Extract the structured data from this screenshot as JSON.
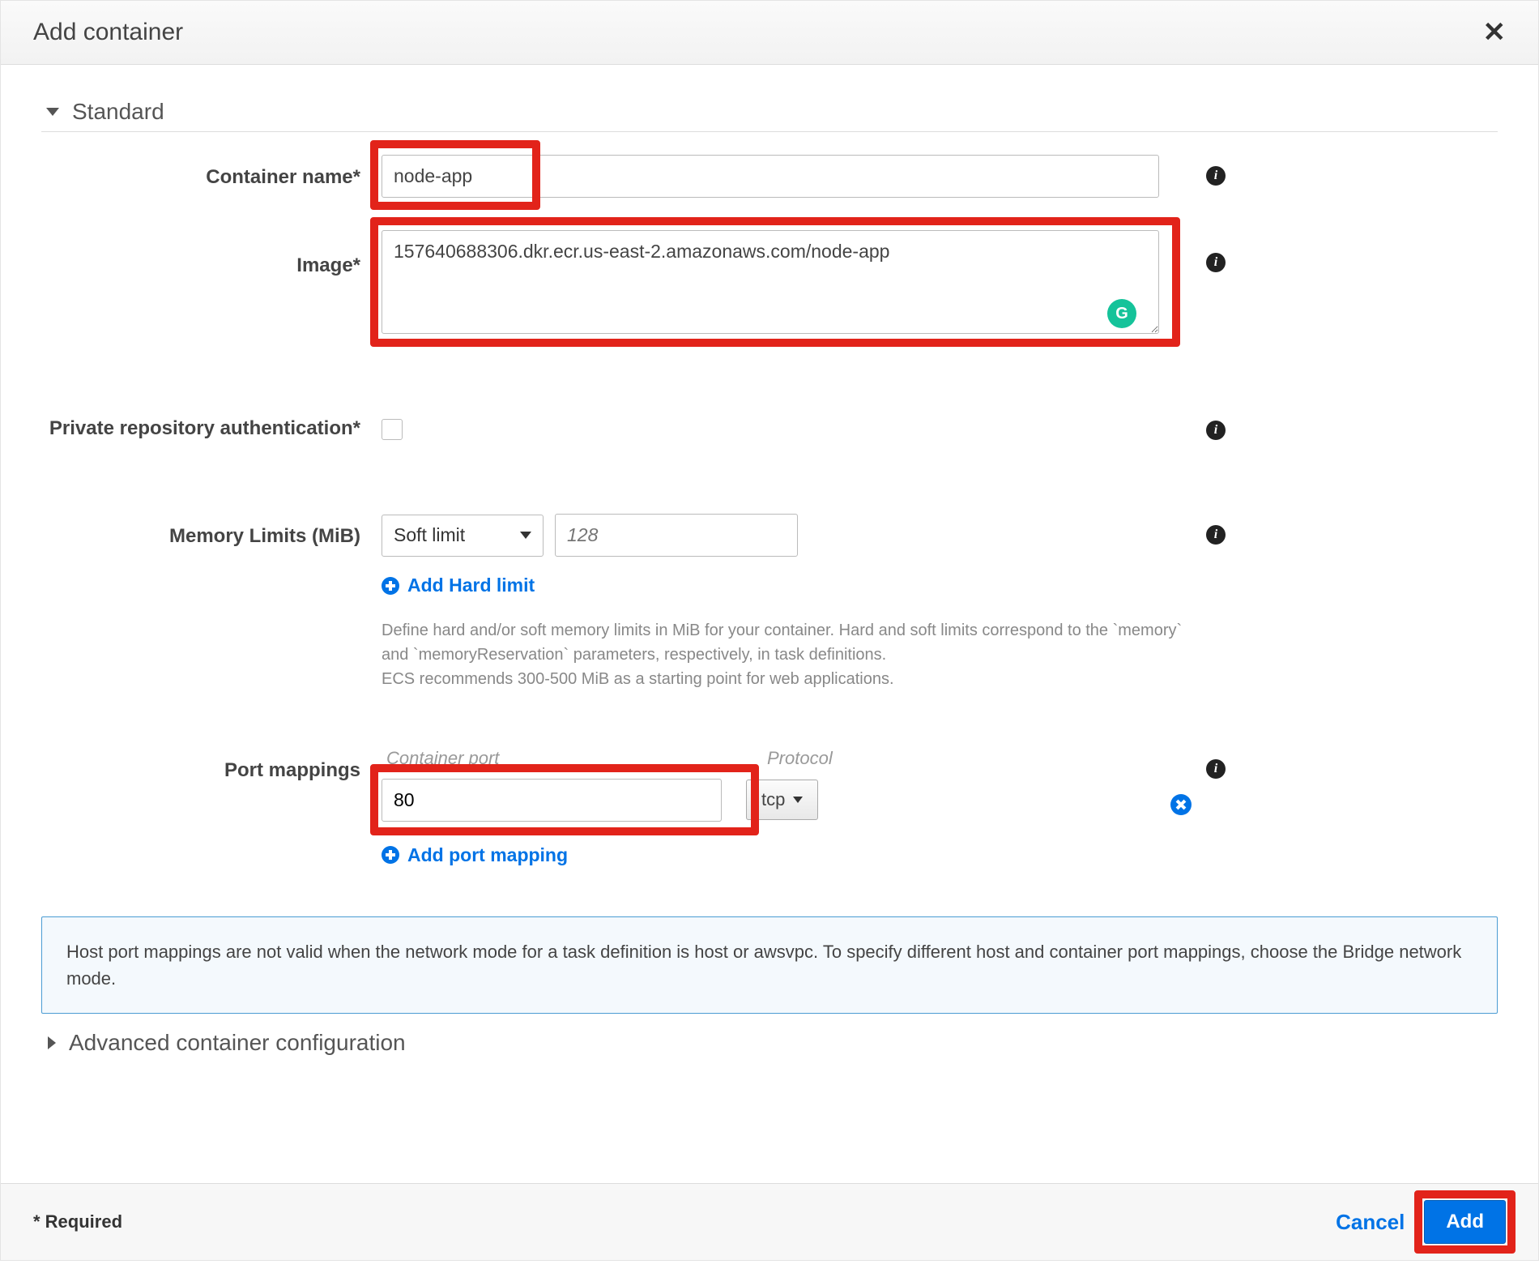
{
  "modal": {
    "title": "Add container",
    "close_glyph": "✕"
  },
  "section_standard": {
    "title": "Standard"
  },
  "section_advanced": {
    "title": "Advanced container configuration"
  },
  "fields": {
    "container_name": {
      "label": "Container name*",
      "value": "node-app"
    },
    "image": {
      "label": "Image*",
      "value": "157640688306.dkr.ecr.us-east-2.amazonaws.com/node-app"
    },
    "private_repo_auth": {
      "label": "Private repository authentication*"
    },
    "memory_limits": {
      "label": "Memory Limits (MiB)",
      "select_value": "Soft limit",
      "input_placeholder": "128",
      "add_hard_limit_label": "Add Hard limit",
      "help": "Define hard and/or soft memory limits in MiB for your container. Hard and soft limits correspond to the `memory` and `memoryReservation` parameters, respectively, in task definitions.\nECS recommends 300-500 MiB as a starting point for web applications."
    },
    "port_mappings": {
      "label": "Port mappings",
      "header_container_port": "Container port",
      "header_protocol": "Protocol",
      "rows": [
        {
          "container_port": "80",
          "protocol": "tcp"
        }
      ],
      "add_mapping_label": "Add port mapping"
    }
  },
  "info_panel": "Host port mappings are not valid when the network mode for a task definition is host or awsvpc. To specify different host and container port mappings, choose the Bridge network mode.",
  "footer": {
    "required_note": "* Required",
    "cancel": "Cancel",
    "add": "Add"
  },
  "icons": {
    "info_glyph": "i",
    "grammarly_glyph": "G"
  }
}
